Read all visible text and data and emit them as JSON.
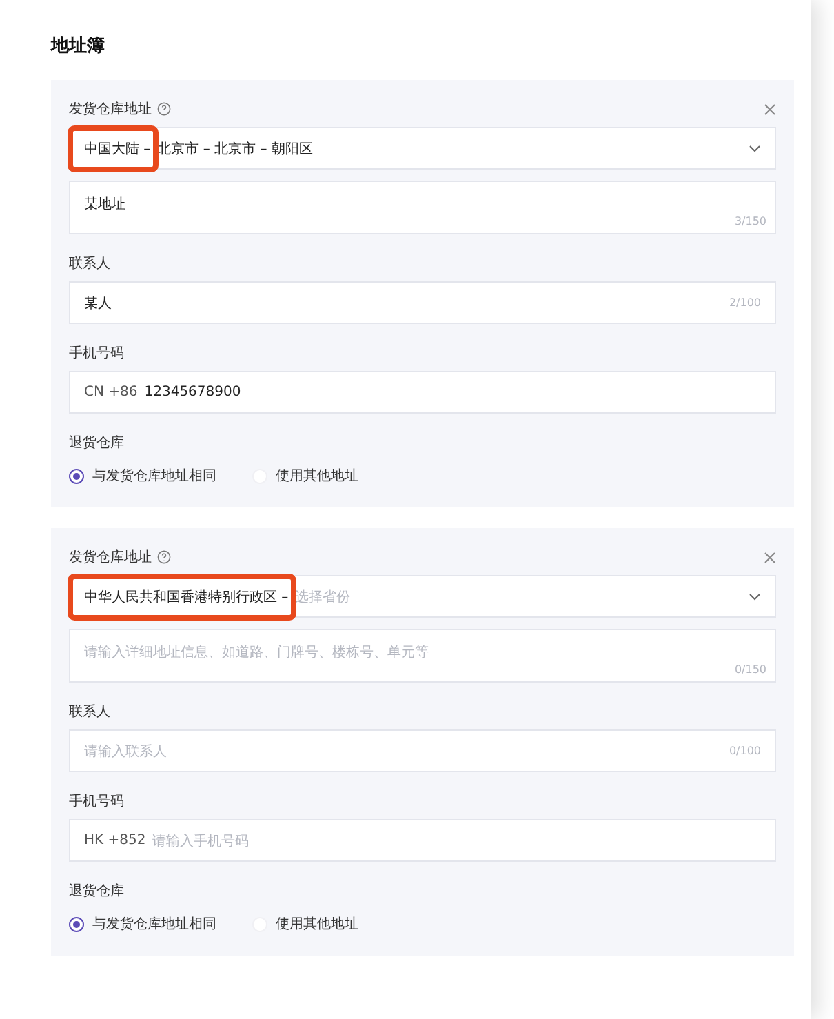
{
  "title": "地址簿",
  "addresses": [
    {
      "region_label": "发货仓库地址",
      "region": {
        "parts": [
          "中国大陆 –",
          "北京市 – 北京市 – 朝阳区"
        ],
        "highlight": true
      },
      "detail": {
        "value": "某地址",
        "counter": "3/150"
      },
      "contact_label": "联系人",
      "contact": {
        "value": "某人",
        "counter": "2/100"
      },
      "phone_label": "手机号码",
      "phone": {
        "prefix": "CN +86",
        "value": "12345678900"
      },
      "return_label": "退货仓库",
      "return_options": [
        {
          "label": "与发货仓库地址相同",
          "selected": true
        },
        {
          "label": "使用其他地址",
          "selected": false
        }
      ]
    },
    {
      "region_label": "发货仓库地址",
      "region": {
        "parts": [
          "中华人民共和国香港特别行政区 –"
        ],
        "placeholder": "选择省份",
        "highlight": true
      },
      "detail": {
        "placeholder": "请输入详细地址信息、如道路、门牌号、楼栋号、单元等",
        "counter": "0/150"
      },
      "contact_label": "联系人",
      "contact": {
        "placeholder": "请输入联系人",
        "counter": "0/100"
      },
      "phone_label": "手机号码",
      "phone": {
        "prefix": "HK +852",
        "placeholder": "请输入手机号码"
      },
      "return_label": "退货仓库",
      "return_options": [
        {
          "label": "与发货仓库地址相同",
          "selected": true
        },
        {
          "label": "使用其他地址",
          "selected": false
        }
      ]
    }
  ]
}
